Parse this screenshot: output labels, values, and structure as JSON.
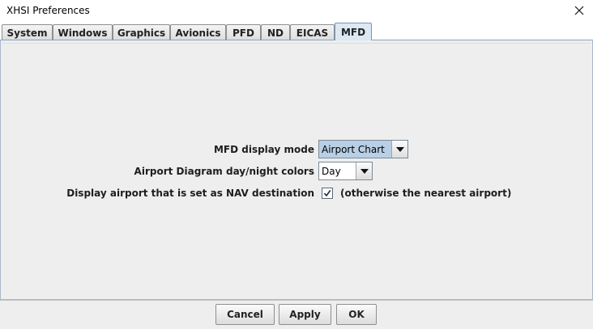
{
  "window": {
    "title": "XHSI Preferences"
  },
  "tabs": [
    {
      "label": "System"
    },
    {
      "label": "Windows"
    },
    {
      "label": "Graphics"
    },
    {
      "label": "Avionics"
    },
    {
      "label": "PFD"
    },
    {
      "label": "ND"
    },
    {
      "label": "EICAS"
    },
    {
      "label": "MFD",
      "selected": true
    }
  ],
  "mfd": {
    "display_mode_label": "MFD display mode",
    "display_mode_value": "Airport Chart",
    "diagram_colors_label": "Airport Diagram day/night colors",
    "diagram_colors_value": "Day",
    "nav_dest_label": "Display airport that is set as NAV destination",
    "nav_dest_checked": true,
    "nav_dest_note": "(otherwise the nearest airport)"
  },
  "buttons": {
    "cancel": "Cancel",
    "apply": "Apply",
    "ok": "OK"
  },
  "colors": {
    "selected_tab": "#dce8f4",
    "combo_highlight": "#b8cfe5",
    "panel": "#eeeeee"
  },
  "icons": {
    "close": "close-icon",
    "dropdown": "chevron-down-icon",
    "check": "check-icon"
  }
}
